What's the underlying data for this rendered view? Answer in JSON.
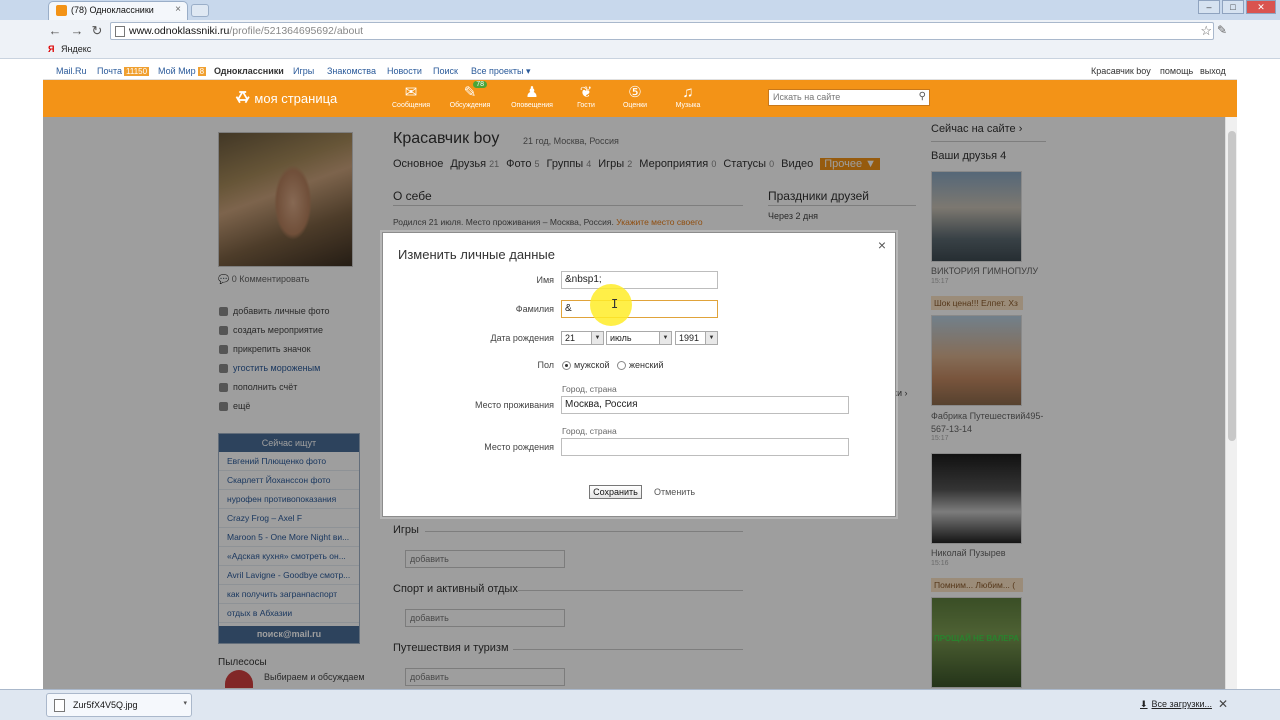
{
  "browser": {
    "tab_title": "(78) Одноклассники",
    "url_host": "www.odnoklassniki.ru",
    "url_path": "/profile/521364695692/about",
    "bookmark": "Яндекс",
    "win_min": "–",
    "win_max": "□",
    "win_close": "✕"
  },
  "portal_bar": {
    "mailru": "Mail.Ru",
    "pochta": "Почта",
    "pochta_count": "11150",
    "moy_mir": "Мой Мир",
    "moy_mir_count": "8",
    "odnoklassniki": "Одноклассники",
    "igry": "Игры",
    "znakomstva": "Знакомства",
    "novosti": "Новости",
    "poisk": "Поиск",
    "vse_proekty": "Все проекты ▾",
    "user": "Красавчик boy",
    "help": "помощь",
    "logout": "выход"
  },
  "top_nav": {
    "my_page": "моя страница",
    "messages": "Сообщения",
    "discussions": "Обсуждения",
    "discussions_badge": "78",
    "alerts": "Оповещения",
    "guests": "Гости",
    "ratings": "Оценки",
    "music": "Музыка",
    "search_placeholder": "Искать на сайте"
  },
  "profile": {
    "name": "Красавчик boy",
    "subinfo": "21 год, Москва, Россия",
    "comment_count": "0",
    "comment_label": "Комментировать",
    "tabs": [
      {
        "label": "Основное",
        "count": ""
      },
      {
        "label": "Друзья",
        "count": "21"
      },
      {
        "label": "Фото",
        "count": "5"
      },
      {
        "label": "Группы",
        "count": "4"
      },
      {
        "label": "Игры",
        "count": "2"
      },
      {
        "label": "Мероприятия",
        "count": "0"
      },
      {
        "label": "Статусы",
        "count": "0"
      },
      {
        "label": "Видео",
        "count": ""
      }
    ],
    "more_tab": "Прочее ▼",
    "actions": [
      "добавить личные фото",
      "создать мероприятие",
      "прикрепить значок",
      "угостить мороженым",
      "пополнить счёт",
      "ещё"
    ]
  },
  "now_searching": {
    "header": "Сейчас ищут",
    "items": [
      "Евгений Плющенко фото",
      "Скарлетт Йоханссон фото",
      "нурофен противопоказания",
      "Crazy Frog – Axel F",
      "Maroon 5 - One More Night ви...",
      "«Адская кухня» смотреть он...",
      "Avril Lavigne - Goodbye смотр...",
      "как получить загранпаспорт",
      "отдых в Абхазии"
    ],
    "footer": "поиск@mail.ru"
  },
  "group_promo": {
    "title": "Пылесосы",
    "text": "Выбираем и обсуждаем"
  },
  "about": {
    "title": "О себе",
    "text": "Родился 21 июля. Место проживания – Москва, Россия.",
    "link": "Укажите место своего",
    "games_title": "Игры",
    "sport_title": "Спорт и активный отдых",
    "travel_title": "Путешествия и туризм",
    "add": "добавить"
  },
  "friends_holidays": {
    "title": "Праздники друзей",
    "text": "Через 2 дня",
    "more": "ки ›"
  },
  "right_col": {
    "online": "Сейчас на сайте ›",
    "friends": "Ваши друзья 4",
    "friend1_name": "ВИКТОРИЯ ГИМНОПУЛУ",
    "friend1_time": "15:17",
    "friend2_status": "Шок цена!!! Елпет. Хз",
    "friend2_name": "Фабрика Путешествий495-567-13-14",
    "friend2_time": "15:17",
    "friend3_name": "Николай Пузырев",
    "friend3_time": "15:16",
    "friend4_status": "Помним... Любим... (",
    "friend4_promo": "ПРОЩАЙ НЕ ВАЛЕРА"
  },
  "modal": {
    "title": "Изменить личные данные",
    "close": "×",
    "first_name_label": "Имя",
    "first_name_value": "&nbsp1;",
    "last_name_label": "Фамилия",
    "last_name_value": "&",
    "birthdate_label": "Дата рождения",
    "day": "21",
    "month": "июль",
    "year": "1991",
    "gender_label": "Пол",
    "male": "мужской",
    "female": "женский",
    "residence_label": "Место проживания",
    "residence_hint": "Город, страна",
    "residence_value": "Москва, Россия",
    "birthplace_label": "Место рождения",
    "birthplace_hint": "Город, страна",
    "birthplace_value": "",
    "save": "Сохранить",
    "cancel": "Отменить"
  },
  "downloads": {
    "file": "Zur5fX4V5Q.jpg",
    "all": "Все загрузки..."
  },
  "colors": {
    "brand_orange": "#f39317",
    "link_blue": "#2a5a9a",
    "search_header": "#4a6d96"
  }
}
